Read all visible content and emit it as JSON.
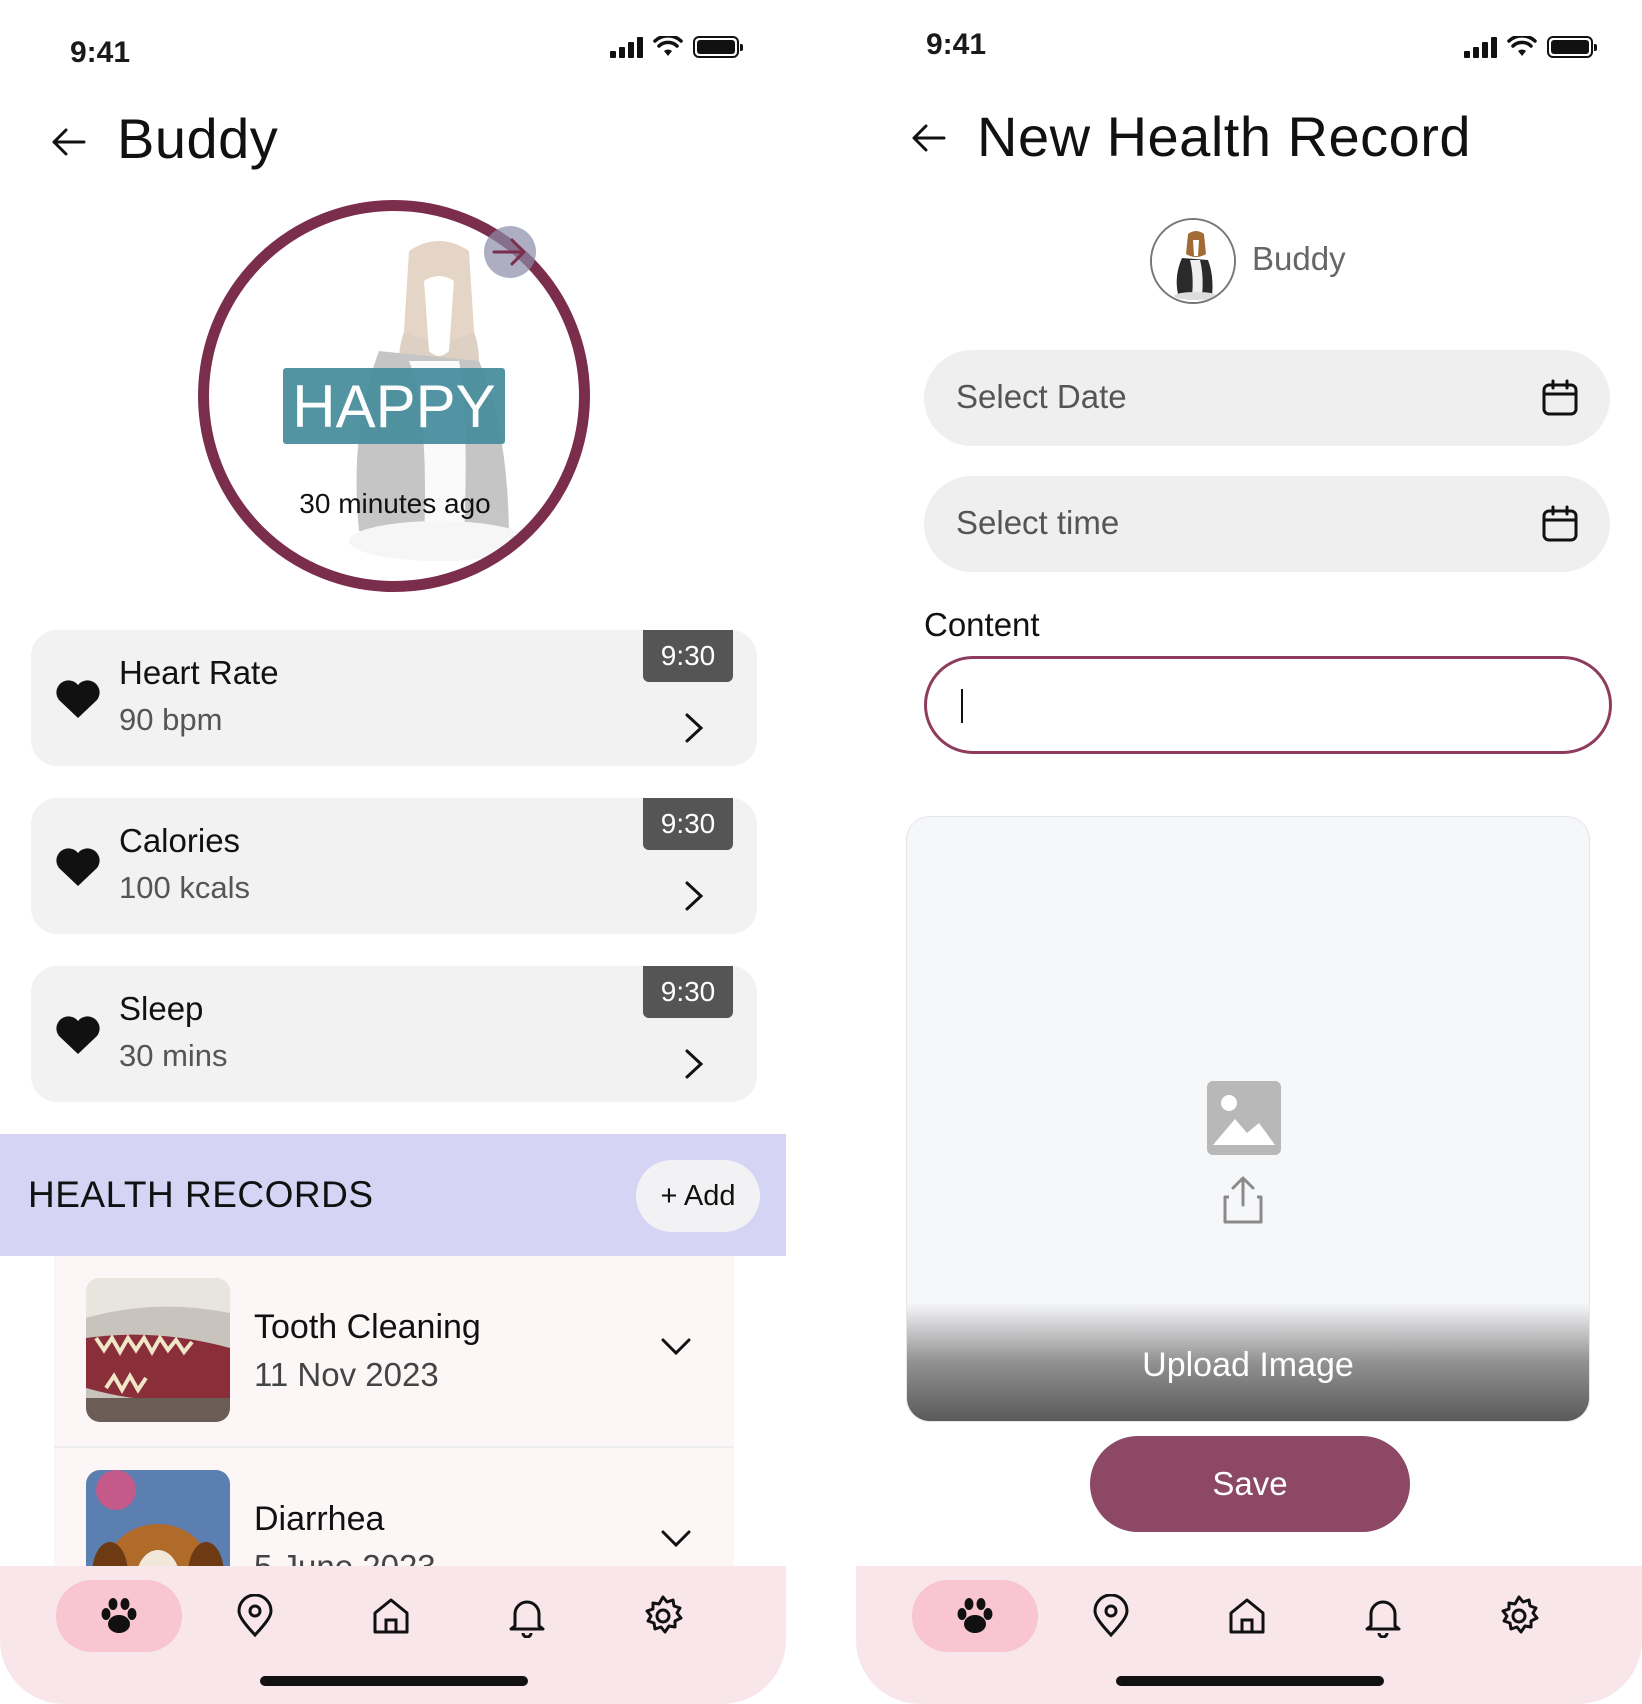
{
  "left_screen": {
    "status": {
      "time": "9:41"
    },
    "header": {
      "title": "Buddy"
    },
    "mood": {
      "label": "HAPPY",
      "time_ago": "30 minutes ago"
    },
    "metrics": [
      {
        "label": "Heart Rate",
        "value": "90 bpm",
        "time": "9:30"
      },
      {
        "label": "Calories",
        "value": "100 kcals",
        "time": "9:30"
      },
      {
        "label": "Sleep",
        "value": "30 mins",
        "time": "9:30"
      }
    ],
    "health_records": {
      "title": "HEALTH RECORDS",
      "add_label": "+ Add",
      "items": [
        {
          "name": "Tooth Cleaning",
          "date": "11 Nov 2023"
        },
        {
          "name": "Diarrhea",
          "date": "5 June 2023"
        }
      ]
    }
  },
  "right_screen": {
    "status": {
      "time": "9:41"
    },
    "header": {
      "title": "New Health Record"
    },
    "pet": {
      "name": "Buddy"
    },
    "date_field": {
      "placeholder": "Select Date"
    },
    "time_field": {
      "placeholder": "Select time"
    },
    "content": {
      "label": "Content",
      "value": ""
    },
    "upload": {
      "label": "Upload Image"
    },
    "save_label": "Save"
  },
  "bottom_nav": {
    "items": [
      "paw-icon",
      "location-pin-icon",
      "home-icon",
      "bell-icon",
      "gear-icon"
    ],
    "active": "paw-icon"
  },
  "colors": {
    "accent_maroon": "#7a2e4c",
    "save_button": "#8c4865",
    "mood_badge": "#4a8f9f",
    "records_bar": "#d6d4f4",
    "nav_bg": "#f8e6ea",
    "nav_active": "#f8c5d0"
  }
}
